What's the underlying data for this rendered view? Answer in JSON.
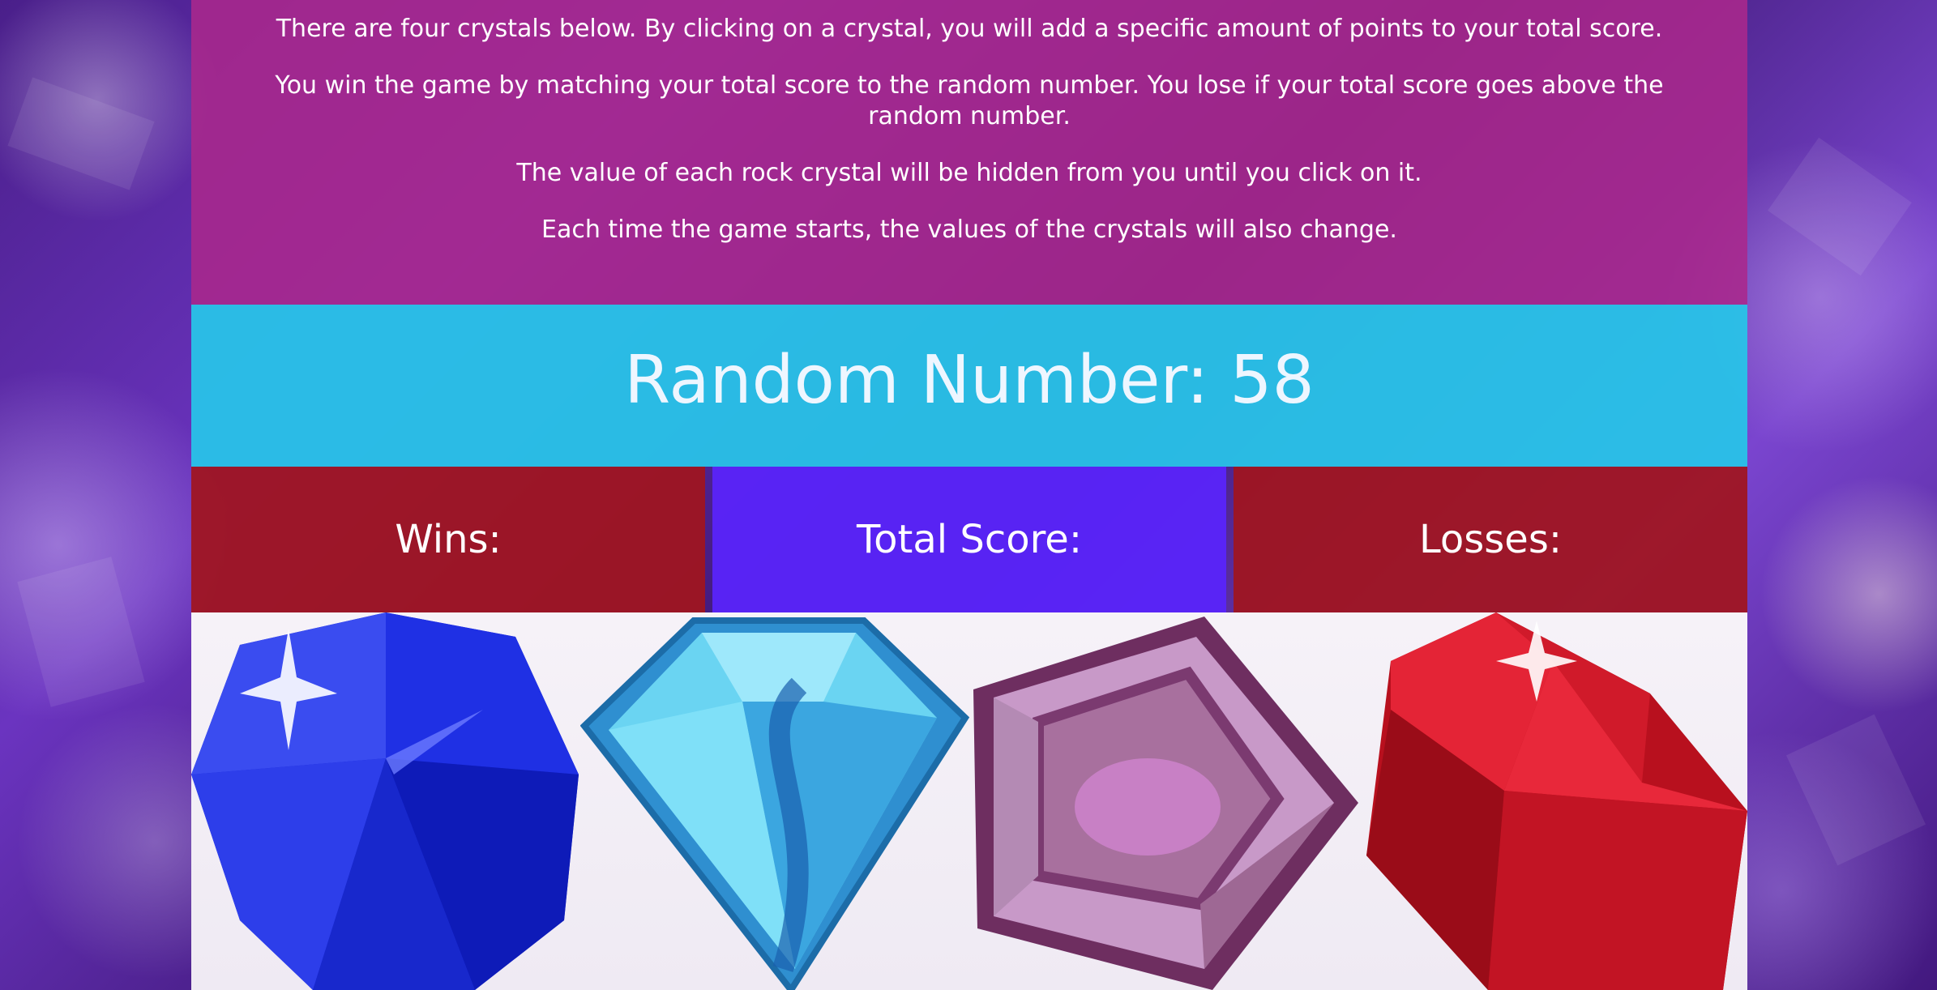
{
  "instructions": {
    "line1": "There are four crystals below. By clicking on a crystal, you will add a specific amount of points to your total score.",
    "line2": "You win the game by matching your total score to the random number. You lose if your total score goes above the random number.",
    "line3": "The value of each rock crystal will be hidden from you until you click on it.",
    "line4": "Each time the game starts, the values of the crystals will also change."
  },
  "random": {
    "label": "Random Number: 58"
  },
  "stats": {
    "wins_label": "Wins:",
    "total_label": "Total Score:",
    "losses_label": "Losses:"
  },
  "crystals": [
    {
      "name": "blue-sapphire",
      "color": "#1f2fe0"
    },
    {
      "name": "light-blue-diamond",
      "color": "#5cc8ee"
    },
    {
      "name": "purple-amethyst",
      "color": "#b88ab8"
    },
    {
      "name": "red-ruby",
      "color": "#d61a2c"
    }
  ],
  "colors": {
    "instructions_bg": "#aa288c",
    "random_bg": "#28c3e8",
    "wins_bg": "#a0141e",
    "total_bg": "#5a24fa",
    "losses_bg": "#a0141e"
  }
}
